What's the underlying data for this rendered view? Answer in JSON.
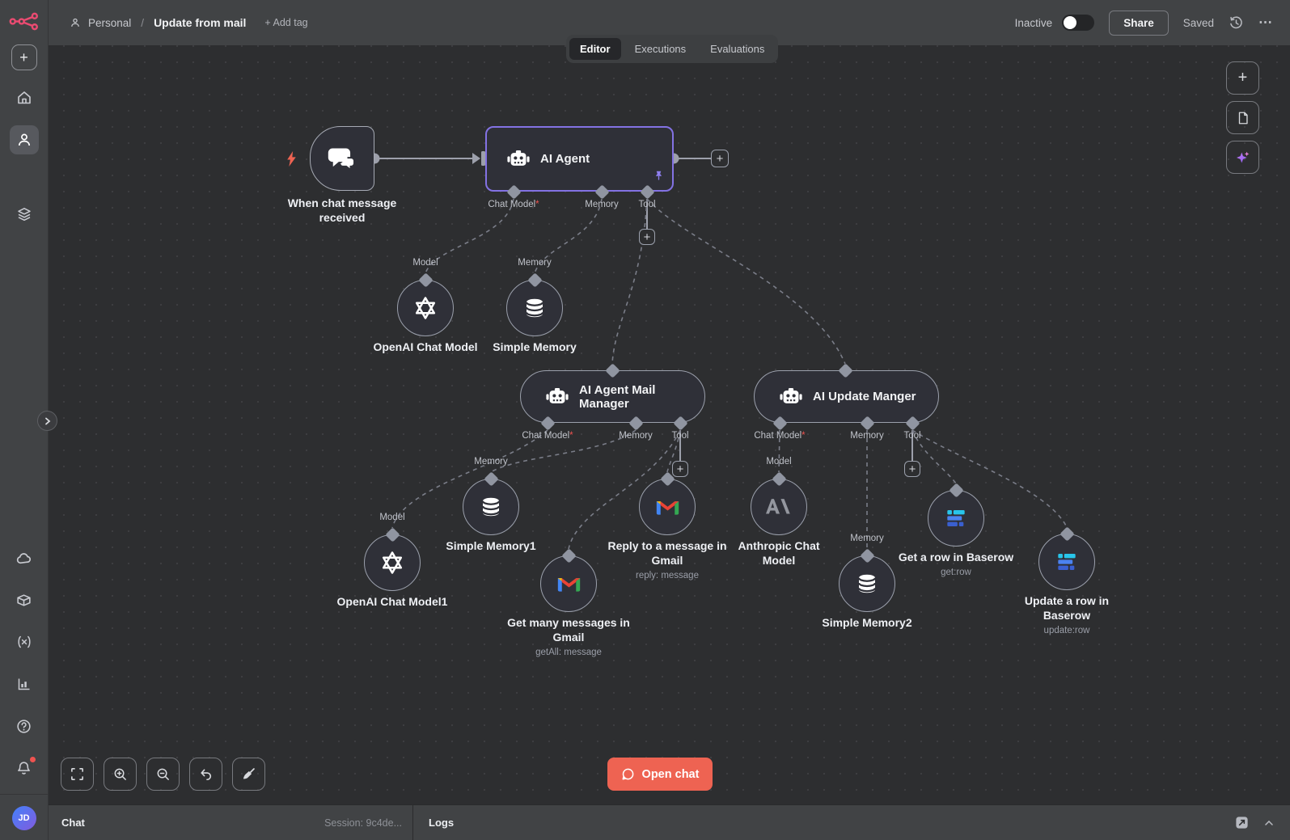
{
  "header": {
    "breadcrumb_project": "Personal",
    "breadcrumb_separator": "/",
    "workflow_title": "Update from mail",
    "add_tag_label": "+ Add tag",
    "status_label": "Inactive",
    "share_label": "Share",
    "saved_label": "Saved"
  },
  "tabs": [
    {
      "label": "Editor",
      "active": true
    },
    {
      "label": "Executions",
      "active": false
    },
    {
      "label": "Evaluations",
      "active": false
    }
  ],
  "sidebar": {
    "icons": [
      "plus",
      "home",
      "user",
      "layers",
      "cloud",
      "package",
      "variables",
      "insights",
      "help",
      "bell"
    ],
    "avatar_initials": "JD",
    "notification_dot": true
  },
  "canvas": {
    "nodes": [
      {
        "id": "chat-trigger",
        "type": "trigger",
        "icon": "chat",
        "label": "When chat message received"
      },
      {
        "id": "ai-agent",
        "type": "agent",
        "icon": "robot",
        "label": "AI Agent",
        "pinned": true,
        "ports": [
          {
            "label": "Chat Model",
            "required": true
          },
          {
            "label": "Memory",
            "required": false
          },
          {
            "label": "Tool",
            "required": false
          }
        ]
      },
      {
        "id": "openai-1",
        "type": "circle",
        "icon": "openai",
        "top_label": "Model",
        "label": "OpenAI Chat Model"
      },
      {
        "id": "simple-memory",
        "type": "circle",
        "icon": "database",
        "top_label": "Memory",
        "label": "Simple Memory"
      },
      {
        "id": "mail-manager",
        "type": "agent",
        "icon": "robot",
        "label": "AI Agent Mail Manager",
        "ports": [
          {
            "label": "Chat Model",
            "required": true
          },
          {
            "label": "Memory",
            "required": false
          },
          {
            "label": "Tool",
            "required": false
          }
        ]
      },
      {
        "id": "update-manger",
        "type": "agent",
        "icon": "robot",
        "label": "AI Update Manger",
        "ports": [
          {
            "label": "Chat Model",
            "required": true
          },
          {
            "label": "Memory",
            "required": false
          },
          {
            "label": "Tool",
            "required": false
          }
        ]
      },
      {
        "id": "simple-memory1",
        "type": "circle",
        "icon": "database",
        "top_label": "Memory",
        "label": "Simple Memory1"
      },
      {
        "id": "reply-gmail",
        "type": "circle",
        "icon": "gmail",
        "label": "Reply to a message in Gmail",
        "sub": "reply: message"
      },
      {
        "id": "openai-2",
        "type": "circle",
        "icon": "openai",
        "top_label": "Model",
        "label": "OpenAI Chat Model1"
      },
      {
        "id": "get-many-gmail",
        "type": "circle",
        "icon": "gmail",
        "label": "Get many messages in Gmail",
        "sub": "getAll: message"
      },
      {
        "id": "anthropic",
        "type": "circle",
        "icon": "anthropic",
        "top_label": "Model",
        "label": "Anthropic Chat Model"
      },
      {
        "id": "simple-memory2",
        "type": "circle",
        "icon": "database",
        "top_label": "Memory",
        "label": "Simple Memory2"
      },
      {
        "id": "get-row-baserow",
        "type": "circle",
        "icon": "baserow",
        "label": "Get a row in Baserow",
        "sub": "get:row"
      },
      {
        "id": "update-row-baserow",
        "type": "circle",
        "icon": "baserow",
        "label": "Update a row in Baserow",
        "sub": "update:row"
      }
    ]
  },
  "chat_panel": {
    "open_chat_label": "Open chat"
  },
  "bottombar": {
    "chat_label": "Chat",
    "session_label": "Session: 9c4de...",
    "logs_label": "Logs"
  },
  "colors": {
    "brand_pink": "#ea4b71",
    "accent_purple": "#8372e3",
    "primary_coral": "#ee6352",
    "chrome_bg": "#414345",
    "canvas_bg": "#2d2e30",
    "node_fill": "#2f3038",
    "node_border": "#9ba0ac"
  }
}
